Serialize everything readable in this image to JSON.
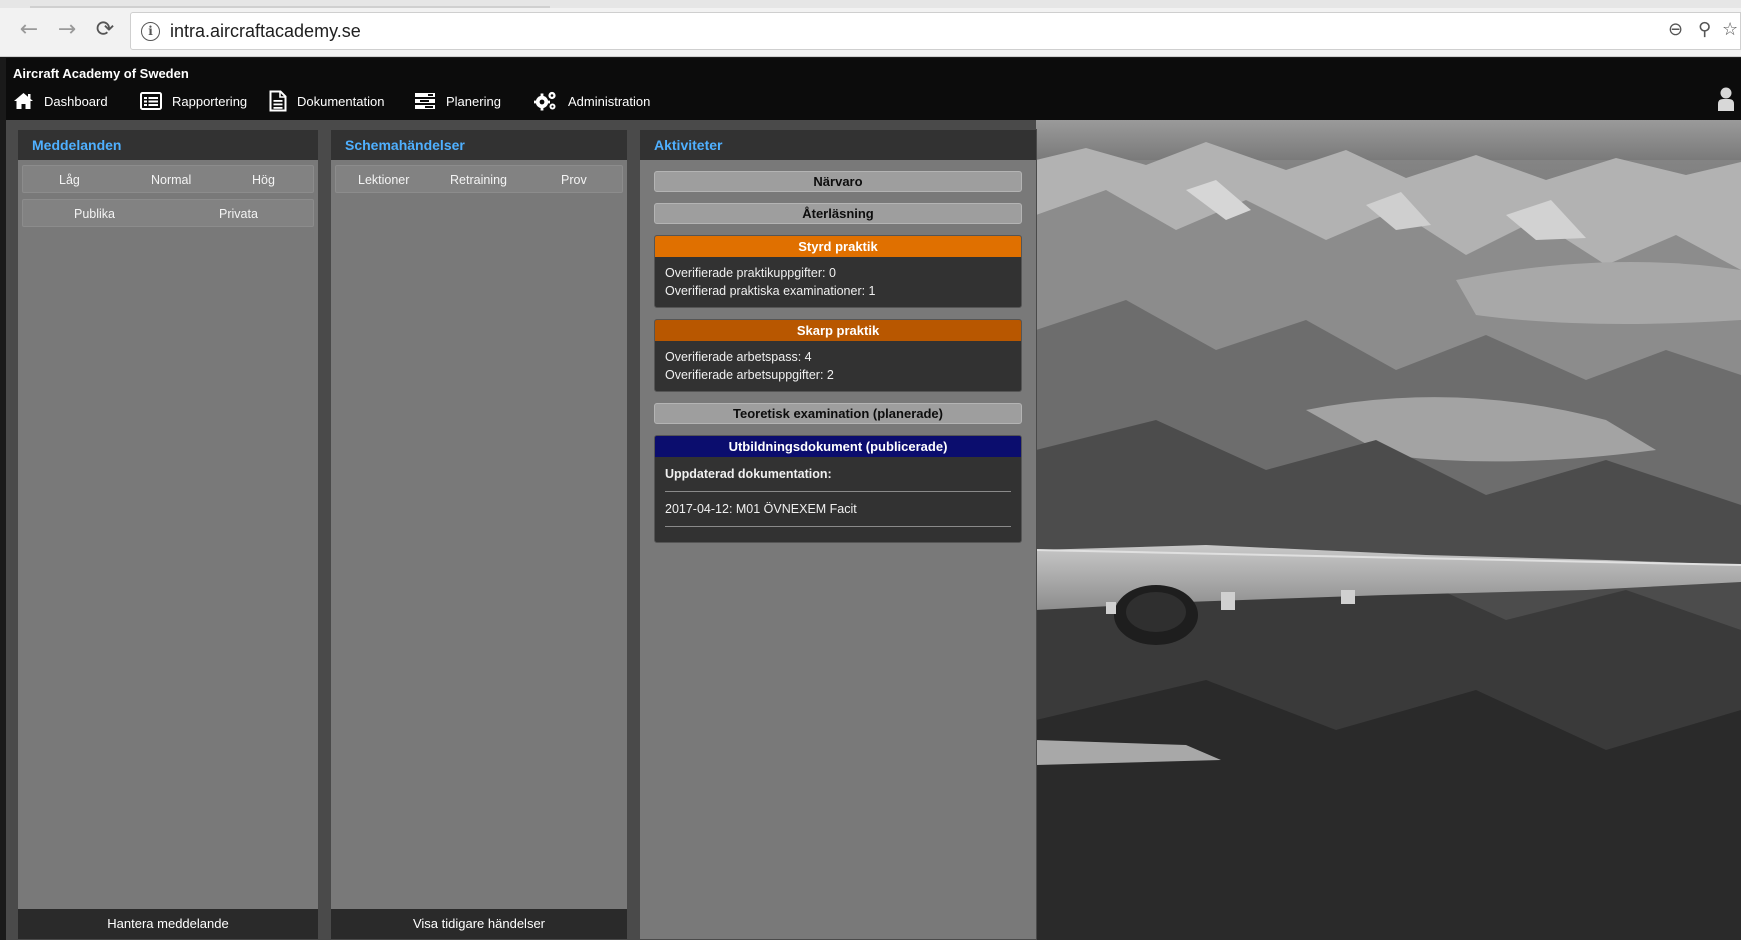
{
  "browser": {
    "url": "intra.aircraftacademy.se",
    "back_icon": "back-arrow-icon",
    "forward_icon": "forward-arrow-icon",
    "reload_icon": "reload-icon",
    "right_icons": [
      "zoom-out-icon",
      "pin-icon",
      "star-icon"
    ]
  },
  "app": {
    "brand": "Aircraft Academy of Sweden",
    "nav": [
      {
        "label": "Dashboard",
        "icon": "home-icon"
      },
      {
        "label": "Rapportering",
        "icon": "list-icon"
      },
      {
        "label": "Dokumentation",
        "icon": "document-icon"
      },
      {
        "label": "Planering",
        "icon": "tasks-icon"
      },
      {
        "label": "Administration",
        "icon": "gears-icon"
      }
    ],
    "user_icon": "user-icon"
  },
  "panels": {
    "meddelanden": {
      "title": "Meddelanden",
      "priority_filters": [
        "Låg",
        "Normal",
        "Hög"
      ],
      "scope_filters": [
        "Publika",
        "Privata"
      ],
      "footer": "Hantera meddelande"
    },
    "schema": {
      "title": "Schemahändelser",
      "filters": [
        "Lektioner",
        "Retraining",
        "Prov"
      ],
      "footer": "Visa tidigare händelser"
    },
    "aktiviteter": {
      "title": "Aktiviteter",
      "narvaro": "Närvaro",
      "aterlasning": "Återläsning",
      "styrd": {
        "title": "Styrd praktik",
        "line1": "Overifierade praktikuppgifter: 0",
        "line2": "Overifierad praktiska examinationer: 1"
      },
      "skarp": {
        "title": "Skarp praktik",
        "line1": "Overifierade arbetspass: 4",
        "line2": "Overifierade arbetsuppgifter: 2"
      },
      "teoretisk": "Teoretisk examination (planerade)",
      "utbildning": {
        "title": "Utbildningsdokument (publicerade)",
        "heading": "Uppdaterad dokumentation:",
        "entry": "2017-04-12: M01 ÖVNEXEM Facit"
      }
    }
  },
  "colors": {
    "panel_title": "#4fb0ff",
    "styrd_header": "#e07000",
    "skarp_header": "#b85700",
    "utbildning_header": "#0b0d6e"
  }
}
